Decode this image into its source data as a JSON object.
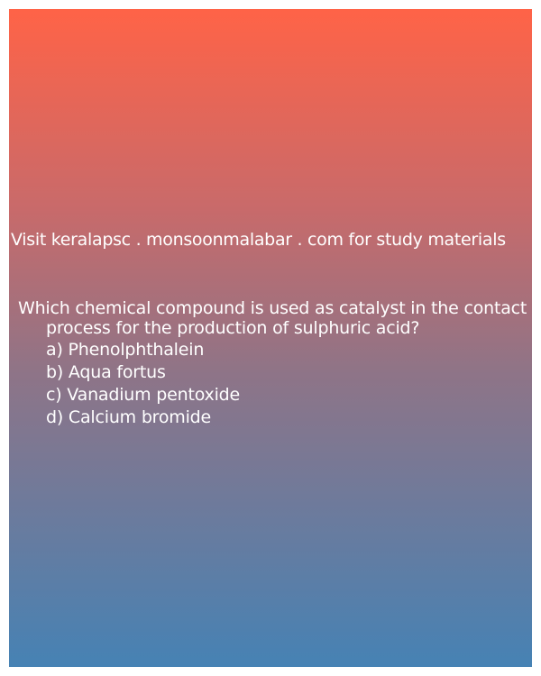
{
  "visit_text": "Visit keralapsc . monsoonmalabar . com for study materials",
  "question": "Which chemical compound is used as catalyst in the contact process for the production of sulphuric acid?",
  "options": [
    "a) Phenolphthalein",
    "b) Aqua fortus",
    "c) Vanadium pentoxide",
    "d) Calcium bromide"
  ],
  "colors": {
    "gradient_top": "#ff6347",
    "gradient_bottom": "#4682b4",
    "text": "#ffffff"
  }
}
